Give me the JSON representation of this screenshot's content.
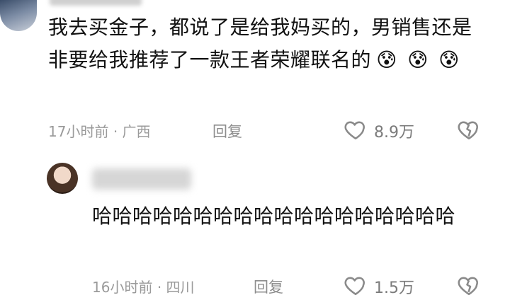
{
  "comments": [
    {
      "text": "我去买金子，都说了是给我妈买的，男销售还是非要给我推荐了一款王者荣耀联名的",
      "emojis": [
        "😰",
        "😰",
        "😰"
      ],
      "time": "17小时前",
      "location": "广西",
      "reply_label": "回复",
      "like_count": "8.9万"
    },
    {
      "text": "哈哈哈哈哈哈哈哈哈哈哈哈哈哈哈哈哈哈",
      "time": "16小时前",
      "location": "四川",
      "reply_label": "回复",
      "like_count": "1.5万"
    }
  ],
  "icons": {
    "like": "heart-outline-icon",
    "dislike": "broken-heart-icon"
  },
  "colors": {
    "meta_text": "#9a9a9a",
    "main_text": "#111111"
  }
}
